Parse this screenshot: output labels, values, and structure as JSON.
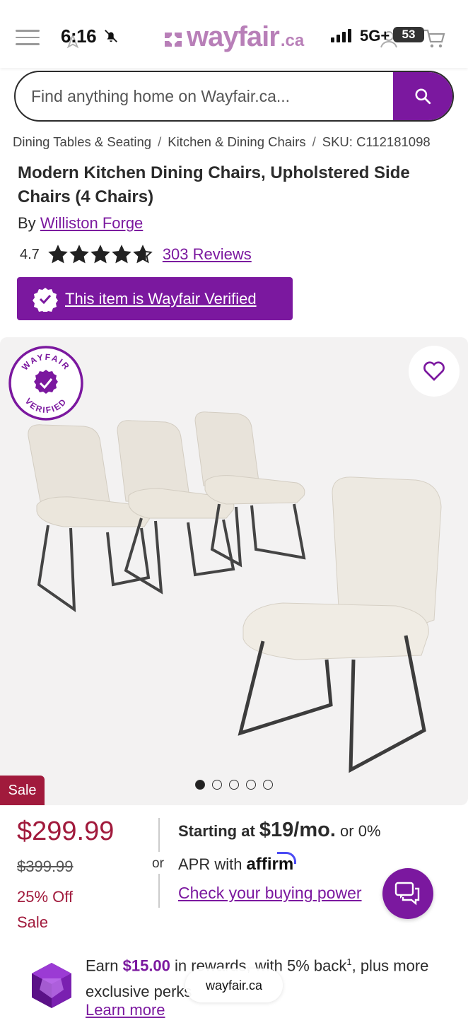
{
  "status_bar": {
    "time": "6:16",
    "network": "5G+",
    "battery": "53"
  },
  "header": {
    "logo_text": "wayfair",
    "logo_tld": ".ca"
  },
  "search": {
    "placeholder": "Find anything home on Wayfair.ca..."
  },
  "breadcrumb": {
    "items": [
      "Dining Tables & Seating",
      "Kitchen & Dining Chairs",
      "SKU: C112181098"
    ],
    "separator": "/"
  },
  "product": {
    "title": "Modern Kitchen Dining Chairs, Upholstered Side Chairs (4 Chairs)",
    "by_label": "By",
    "brand": "Williston Forge",
    "rating": "4.7",
    "rating_value": 4.7,
    "reviews": "303 Reviews",
    "verified_label": "This item is Wayfair Verified",
    "verified_badge_text": [
      "WAYFAIR",
      "VERIFIED"
    ],
    "gallery_count": 5,
    "gallery_active": 0,
    "sale_badge": "Sale"
  },
  "pricing": {
    "price": "$299.99",
    "original_price": "$399.99",
    "discount": "25% Off",
    "sale_text": "Sale",
    "or_text": "or",
    "financing_prefix": "Starting at",
    "financing_amount": "$19/mo.",
    "financing_suffix": "or 0%",
    "financing_line2": "APR with",
    "affirm": "affirm",
    "buying_power_link": "Check your buying power"
  },
  "rewards": {
    "prefix": "Earn",
    "amount": "$15.00",
    "suffix": "in rewards, with 5% back",
    "sup": "1",
    "suffix2": ", plus more exclusive perks",
    "learn_more": "Learn more"
  },
  "browser": {
    "url": "wayfair.ca"
  },
  "colors": {
    "brand": "#7b189f",
    "sale": "#a11a3c"
  }
}
